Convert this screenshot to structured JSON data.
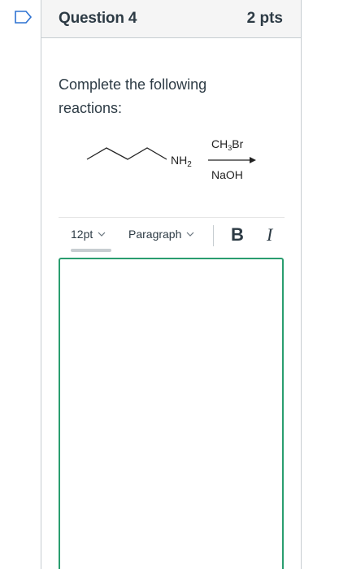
{
  "question": {
    "title": "Question 4",
    "points": "2 pts",
    "text": "Complete the following reactions:"
  },
  "reaction": {
    "product_group": "NH2",
    "reagent_above": "CH3Br",
    "reagent_below": "NaOH"
  },
  "editor_toolbar": {
    "font_size": "12pt",
    "block_format": "Paragraph",
    "bold_label": "B",
    "italic_label": "I"
  },
  "colors": {
    "accent_green": "#2a9d6f",
    "flag_blue": "#2d72d2",
    "text": "#2d3b45"
  }
}
